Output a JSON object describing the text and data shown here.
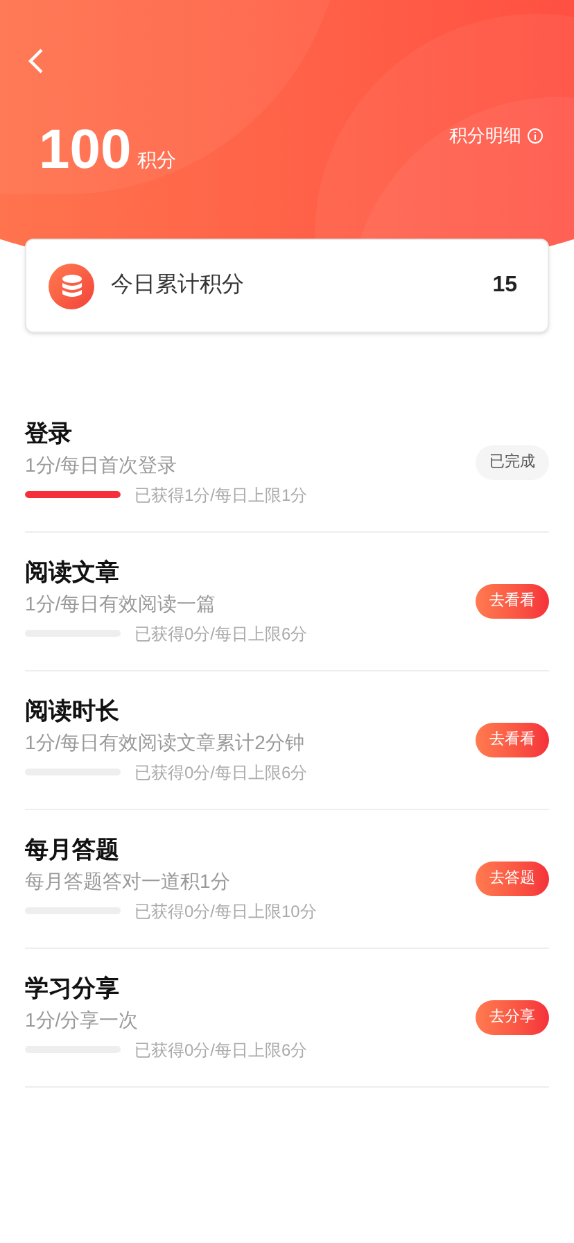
{
  "header": {
    "points": "100",
    "points_unit": "积分",
    "details_link": "积分明细"
  },
  "today": {
    "label": "今日累计积分",
    "value": "15"
  },
  "tasks": [
    {
      "title": "登录",
      "desc": "1分/每日首次登录",
      "level": 1,
      "progress_text": "已获得1分/每日上限1分",
      "button": "已完成",
      "done": true
    },
    {
      "title": "阅读文章",
      "desc": "1分/每日有效阅读一篇",
      "level": 0,
      "progress_text": "已获得0分/每日上限6分",
      "button": "去看看",
      "done": false
    },
    {
      "title": "阅读时长",
      "desc": "1分/每日有效阅读文章累计2分钟",
      "level": 0,
      "progress_text": "已获得0分/每日上限6分",
      "button": "去看看",
      "done": false
    },
    {
      "title": "每月答题",
      "desc": "每月答题答对一道积1分",
      "level": 0,
      "progress_text": "已获得0分/每日上限10分",
      "button": "去答题",
      "done": false
    },
    {
      "title": "学习分享",
      "desc": "1分/分享一次",
      "level": 0,
      "progress_text": "已获得0分/每日上限6分",
      "button": "去分享",
      "done": false
    }
  ]
}
